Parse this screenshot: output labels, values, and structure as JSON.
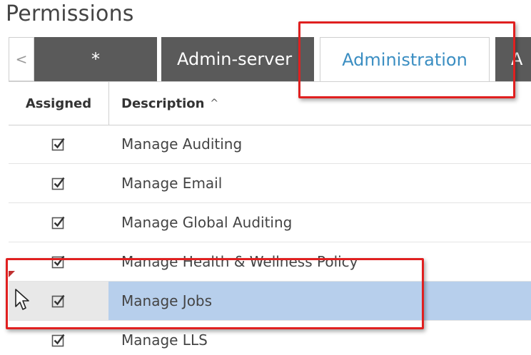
{
  "title": "Permissions",
  "tabs": {
    "scroll_left_glyph": "<",
    "items": [
      {
        "label": "*",
        "state": "inactive"
      },
      {
        "label": "Admin-server",
        "state": "inactive"
      },
      {
        "label": "Administration",
        "state": "active"
      },
      {
        "label": "A",
        "state": "inactive"
      }
    ]
  },
  "grid": {
    "columns": {
      "assigned": "Assigned",
      "description": "Description",
      "sort_glyph": "^"
    },
    "rows": [
      {
        "assigned": true,
        "description": "Manage Auditing"
      },
      {
        "assigned": true,
        "description": "Manage Email"
      },
      {
        "assigned": true,
        "description": "Manage Global Auditing"
      },
      {
        "assigned": true,
        "description": "Manage Health & Wellness Policy"
      },
      {
        "assigned": true,
        "description": "Manage Jobs",
        "selected": true
      },
      {
        "assigned": true,
        "description": "Manage LLS"
      }
    ]
  },
  "colors": {
    "active_tab_text": "#3b8ec2",
    "inactive_tab_bg": "#5a5a5a",
    "selected_row_bg": "#b7cfec",
    "highlight_border": "#e02020"
  }
}
